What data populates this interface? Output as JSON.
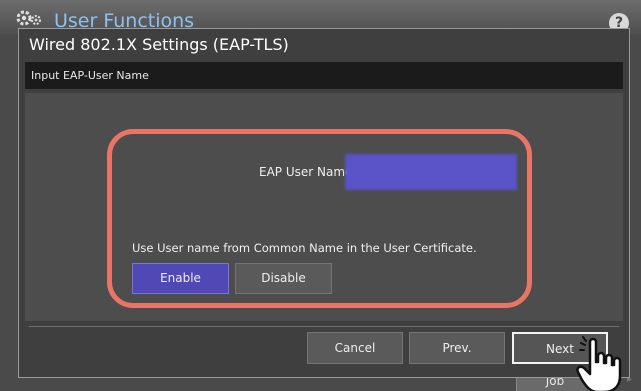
{
  "app": {
    "title": "User Functions",
    "help_label": "?",
    "job_button_label": "Job"
  },
  "dialog": {
    "title": "Wired 802.1X Settings (EAP-TLS)",
    "instruction": "Input EAP-User Name"
  },
  "form": {
    "user_name_label": "EAP User Name",
    "user_name_value": "",
    "user_name_redacted": true,
    "common_name_text": "Use User name from Common Name in the User Certificate.",
    "options": [
      {
        "label": "Enable",
        "selected": true
      },
      {
        "label": "Disable",
        "selected": false
      }
    ]
  },
  "footer": {
    "cancel_label": "Cancel",
    "prev_label": "Prev.",
    "next_label": "Next"
  },
  "colors": {
    "highlight": "#e87566",
    "selected_button": "#5048b4",
    "input_background": "#5a54c8",
    "header_text": "#8fc1f0"
  },
  "icons": [
    "gear-icon",
    "help-icon",
    "hand-pointer-icon"
  ]
}
